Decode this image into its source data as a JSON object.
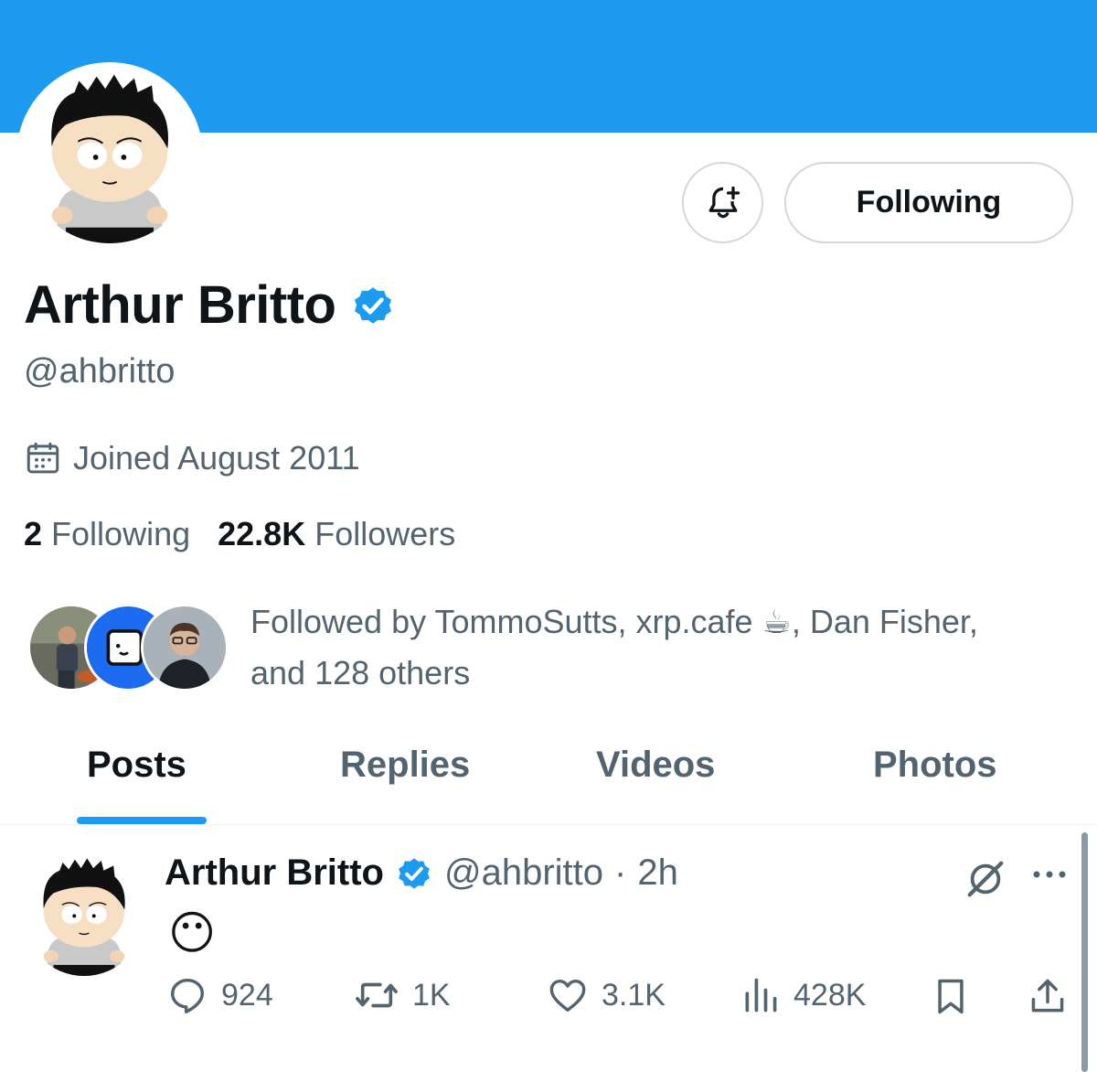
{
  "profile": {
    "name": "Arthur Britto",
    "handle": "@ahbritto",
    "joined": "Joined August 2011",
    "following_count": "2",
    "following_label": "Following",
    "followers_count": "22.8K",
    "followers_label": "Followers",
    "followed_by": "Followed by TommoSutts, xrp.cafe ☕, Dan Fisher, and 128 others"
  },
  "header": {
    "follow_button_label": "Following"
  },
  "tabs": [
    {
      "label": "Posts",
      "active": true
    },
    {
      "label": "Replies",
      "active": false
    },
    {
      "label": "Videos",
      "active": false
    },
    {
      "label": "Photos",
      "active": false
    }
  ],
  "post": {
    "name": "Arthur Britto",
    "handle": "@ahbritto",
    "separator": "·",
    "time": "2h",
    "content": "😶",
    "replies": "924",
    "reposts": "1K",
    "likes": "3.1K",
    "views": "428K"
  },
  "colors": {
    "accent": "#1d9bf0",
    "secondary_text": "#536471",
    "primary_text": "#0f1419"
  },
  "icons": [
    "bell-plus-icon",
    "verified-badge-icon",
    "calendar-icon",
    "grok-icon",
    "more-icon",
    "reply-icon",
    "repost-icon",
    "like-icon",
    "views-icon",
    "bookmark-icon",
    "share-icon"
  ]
}
